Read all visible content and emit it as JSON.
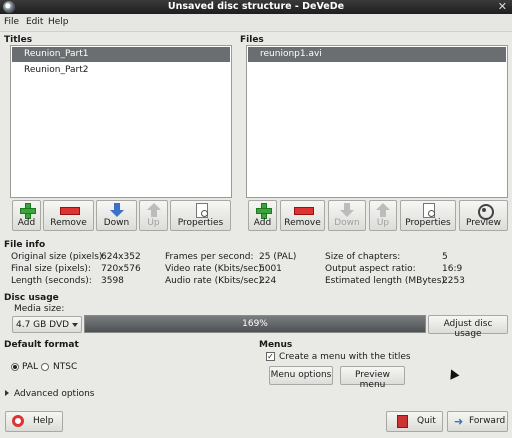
{
  "window": {
    "title": "Unsaved disc structure - DeVeDe"
  },
  "menu": {
    "file": "File",
    "edit": "Edit",
    "help": "Help"
  },
  "titles": {
    "heading": "Titles",
    "items": [
      {
        "label": "Reunion_Part1",
        "selected": true
      },
      {
        "label": "Reunion_Part2",
        "selected": false
      }
    ],
    "buttons": {
      "add": "Add",
      "remove": "Remove",
      "down": "Down",
      "up": "Up",
      "properties": "Properties"
    }
  },
  "files": {
    "heading": "Files",
    "items": [
      {
        "label": "reunionp1.avi",
        "selected": true
      }
    ],
    "buttons": {
      "add": "Add",
      "remove": "Remove",
      "down": "Down",
      "up": "Up",
      "properties": "Properties",
      "preview": "Preview"
    }
  },
  "file_info": {
    "heading": "File info",
    "original_size_label": "Original size (pixels):",
    "original_size": "624x352",
    "final_size_label": "Final size (pixels):",
    "final_size": "720x576",
    "length_label": "Length (seconds):",
    "length": "3598",
    "fps_label": "Frames per second:",
    "fps": "25 (PAL)",
    "video_rate_label": "Video rate (Kbits/sec):",
    "video_rate": "5001",
    "audio_rate_label": "Audio rate (Kbits/sec):",
    "audio_rate": "224",
    "chapters_label": "Size of chapters:",
    "chapters": "5",
    "aspect_label": "Output aspect ratio:",
    "aspect": "16:9",
    "est_length_label": "Estimated length (MBytes):",
    "est_length": "2253"
  },
  "disc_usage": {
    "heading": "Disc usage",
    "media_label": "Media size:",
    "media_value": "4.7 GB DVD",
    "usage_text": "169%",
    "usage_fraction": 1.0,
    "adjust_button": "Adjust disc usage"
  },
  "default_format": {
    "heading": "Default format",
    "pal": "PAL",
    "ntsc": "NTSC",
    "selected": "PAL"
  },
  "menus": {
    "heading": "Menus",
    "create_menu_label": "Create a menu with the titles",
    "create_menu_checked": true,
    "menu_options_button": "Menu options",
    "preview_menu_button": "Preview menu"
  },
  "advanced": {
    "label": "Advanced options"
  },
  "bottom": {
    "help": "Help",
    "quit": "Quit",
    "forward": "Forward"
  },
  "icons": [
    "app-icon",
    "close-icon",
    "add-icon",
    "remove-icon",
    "down-icon",
    "up-icon",
    "properties-icon",
    "preview-icon",
    "help-icon",
    "quit-icon",
    "forward-icon"
  ]
}
